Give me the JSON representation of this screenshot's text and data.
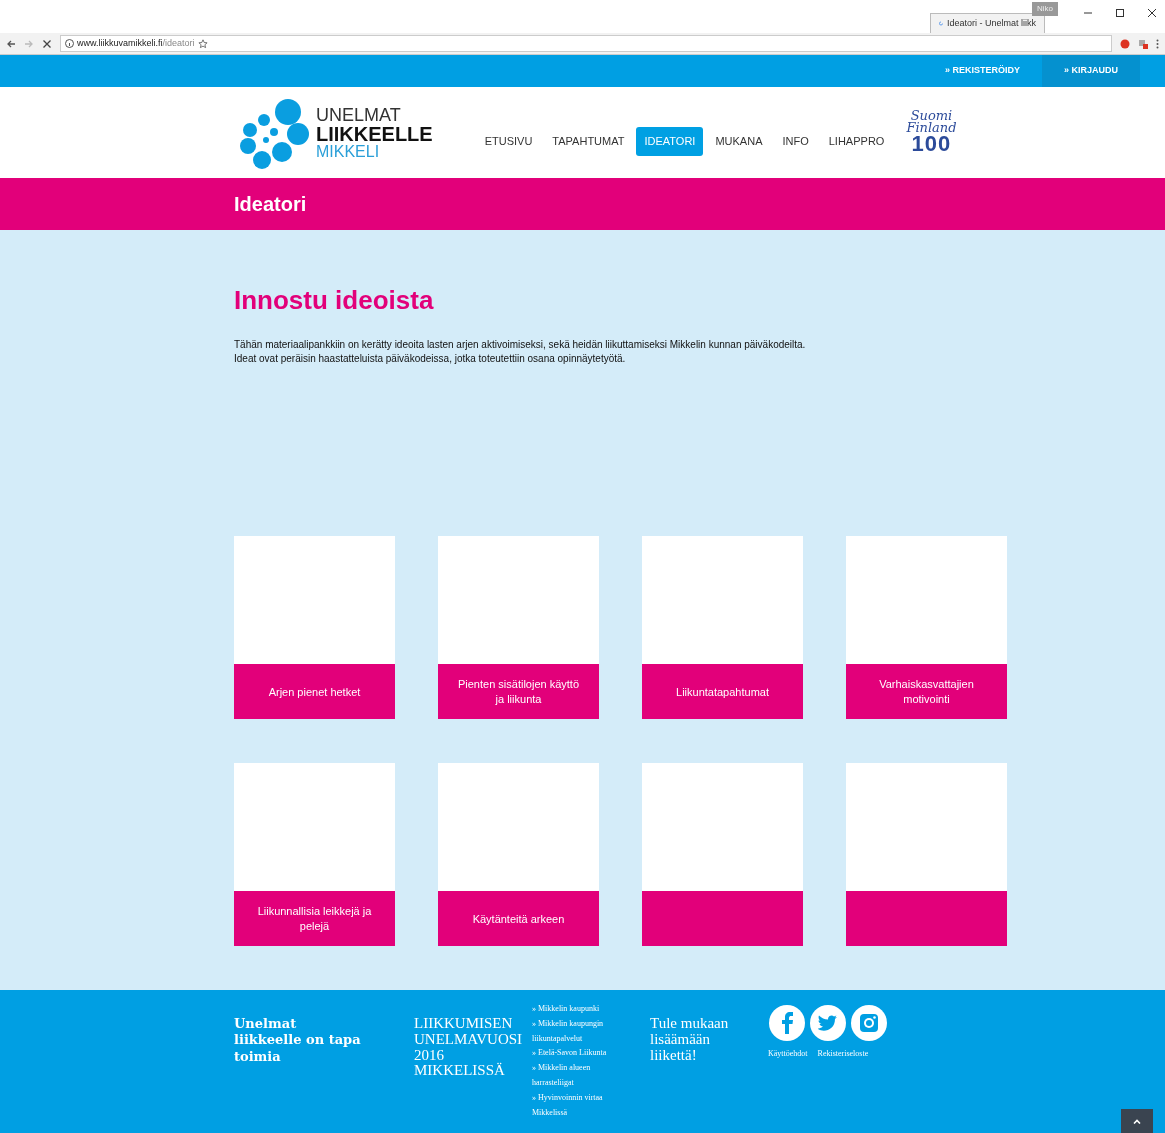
{
  "browser": {
    "tab_title": "Ideatori - Unelmat liikk",
    "profile": "Niko",
    "url_host": "www.liikkuvamikkeli.fi",
    "url_path": "/ideatori"
  },
  "top_bar": {
    "links": [
      {
        "label": "» REKISTERÖIDY",
        "selected": false
      },
      {
        "label": "» KIRJAUDU",
        "selected": true
      }
    ]
  },
  "logo": {
    "lines": [
      "UNELMAT",
      "LIIKKEELLE",
      "MIKKELI"
    ]
  },
  "nav": [
    {
      "label": "ETUSIVU",
      "selected": false
    },
    {
      "label": "TAPAHTUMAT",
      "selected": false
    },
    {
      "label": "IDEATORI",
      "selected": true
    },
    {
      "label": "MUKANA",
      "selected": false
    },
    {
      "label": "INFO",
      "selected": false
    },
    {
      "label": "LIHAPPRO",
      "selected": false
    }
  ],
  "badge": {
    "lines": [
      "Suomi",
      "Finland",
      "100"
    ]
  },
  "page_title": "Ideatori",
  "heading": "Innostu ideoista",
  "intro": [
    "Tähän materiaalipankkiin on kerätty ideoita lasten arjen aktivoimiseksi, sekä heidän liikuttamiseksi Mikkelin kunnan päiväkodeilta.",
    "Ideat ovat peräisin haastatteluista päiväkodeissa, jotka toteutettiin osana opinnäytetyötä."
  ],
  "cards": [
    {
      "kind": "captioned",
      "label": "Arjen pienet hetket"
    },
    {
      "kind": "captioned",
      "label": "Pienten sisätilojen käyttö ja liikunta"
    },
    {
      "kind": "captioned",
      "label": "Liikuntatapahtumat"
    },
    {
      "kind": "captioned",
      "label": "Varhaiskasvattajien motivointi"
    },
    {
      "kind": "captioned",
      "label": "Liikunnallisia leikkejä ja pelejä"
    },
    {
      "kind": "captioned",
      "label": "Käytänteitä arkeen"
    },
    {
      "kind": "blank"
    },
    {
      "kind": "blank"
    }
  ],
  "footer": {
    "tagline": "Unelmat liikkeelle on tapa toimia",
    "campaign": "LIIKKUMISEN UNELMAVUOSI 2016 MIKKELISSÄ",
    "links": [
      "» Mikkelin kaupunki",
      "» Mikkelin kaupungin liikuntapalvelut",
      "» Etelä-Savon Liikunta",
      "» Mikkelin alueen harrasteliigat",
      "» Hyvinvoinnin virtaa Mikkelissä"
    ],
    "call": "Tule mukaan lisäämään liikettä!",
    "social": [
      {
        "kind": "facebook"
      },
      {
        "kind": "twitter"
      },
      {
        "kind": "instagram"
      }
    ],
    "legal": [
      "Käyttöehdot",
      "Rekisteriseloste"
    ]
  }
}
